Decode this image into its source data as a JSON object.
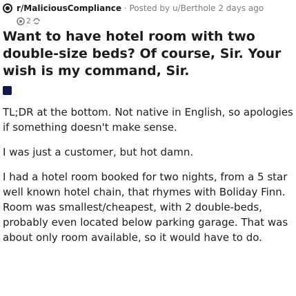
{
  "post": {
    "subreddit": "r/MaliciousCompliance",
    "separator": "·",
    "posted_by": "Posted by u/Berthole",
    "time_ago": "2 days ago",
    "award_count": "2",
    "title": "Want to have hotel room with two double-size beds? Of course, Sir. Your wish is my command, Sir.",
    "paragraphs": [
      "TL;DR at the bottom. Not native in English, so apologies if something doesn't make sense.",
      "I was just a customer, but hot damn.",
      "I had a hotel room booked for two nights, from a 5 star well known hotel chain, that rhymes with Boliday Finn. Room was smallest/cheapest, with 2 double-beds, probably even located below parking garage. That was about only room available, so it would have to do."
    ]
  },
  "colors": {
    "text": "#1c1c1c",
    "meta": "#7c7c7c",
    "flair": "#0d1a4a"
  },
  "icons": [
    "subreddit-icon",
    "award-icon",
    "award-icon"
  ]
}
